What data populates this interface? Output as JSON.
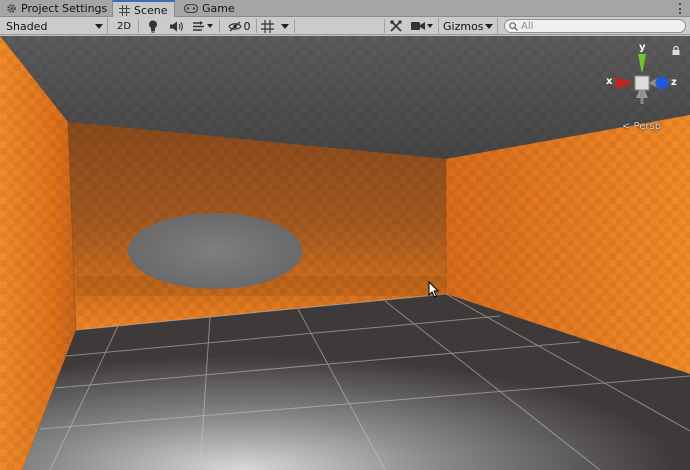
{
  "tabs": [
    {
      "label": "Project Settings",
      "icon": "gear-icon",
      "active": false
    },
    {
      "label": "Scene",
      "icon": "grid-icon",
      "active": true
    },
    {
      "label": "Game",
      "icon": "gamepad-icon",
      "active": false
    }
  ],
  "toolbar": {
    "draw_mode": "Shaded",
    "two_d_label": "2D",
    "hidden_count": "0",
    "gizmos_label": "Gizmos",
    "search_placeholder": "All"
  },
  "scene": {
    "projection_label": "< Persp",
    "axes": {
      "x": "x",
      "y": "y",
      "z": "z"
    }
  },
  "colors": {
    "accent": "#3a72b0",
    "wall_orange": "#e8741a",
    "axis_x": "#c0241c",
    "axis_y": "#6fc52a",
    "axis_z": "#2456d8"
  }
}
